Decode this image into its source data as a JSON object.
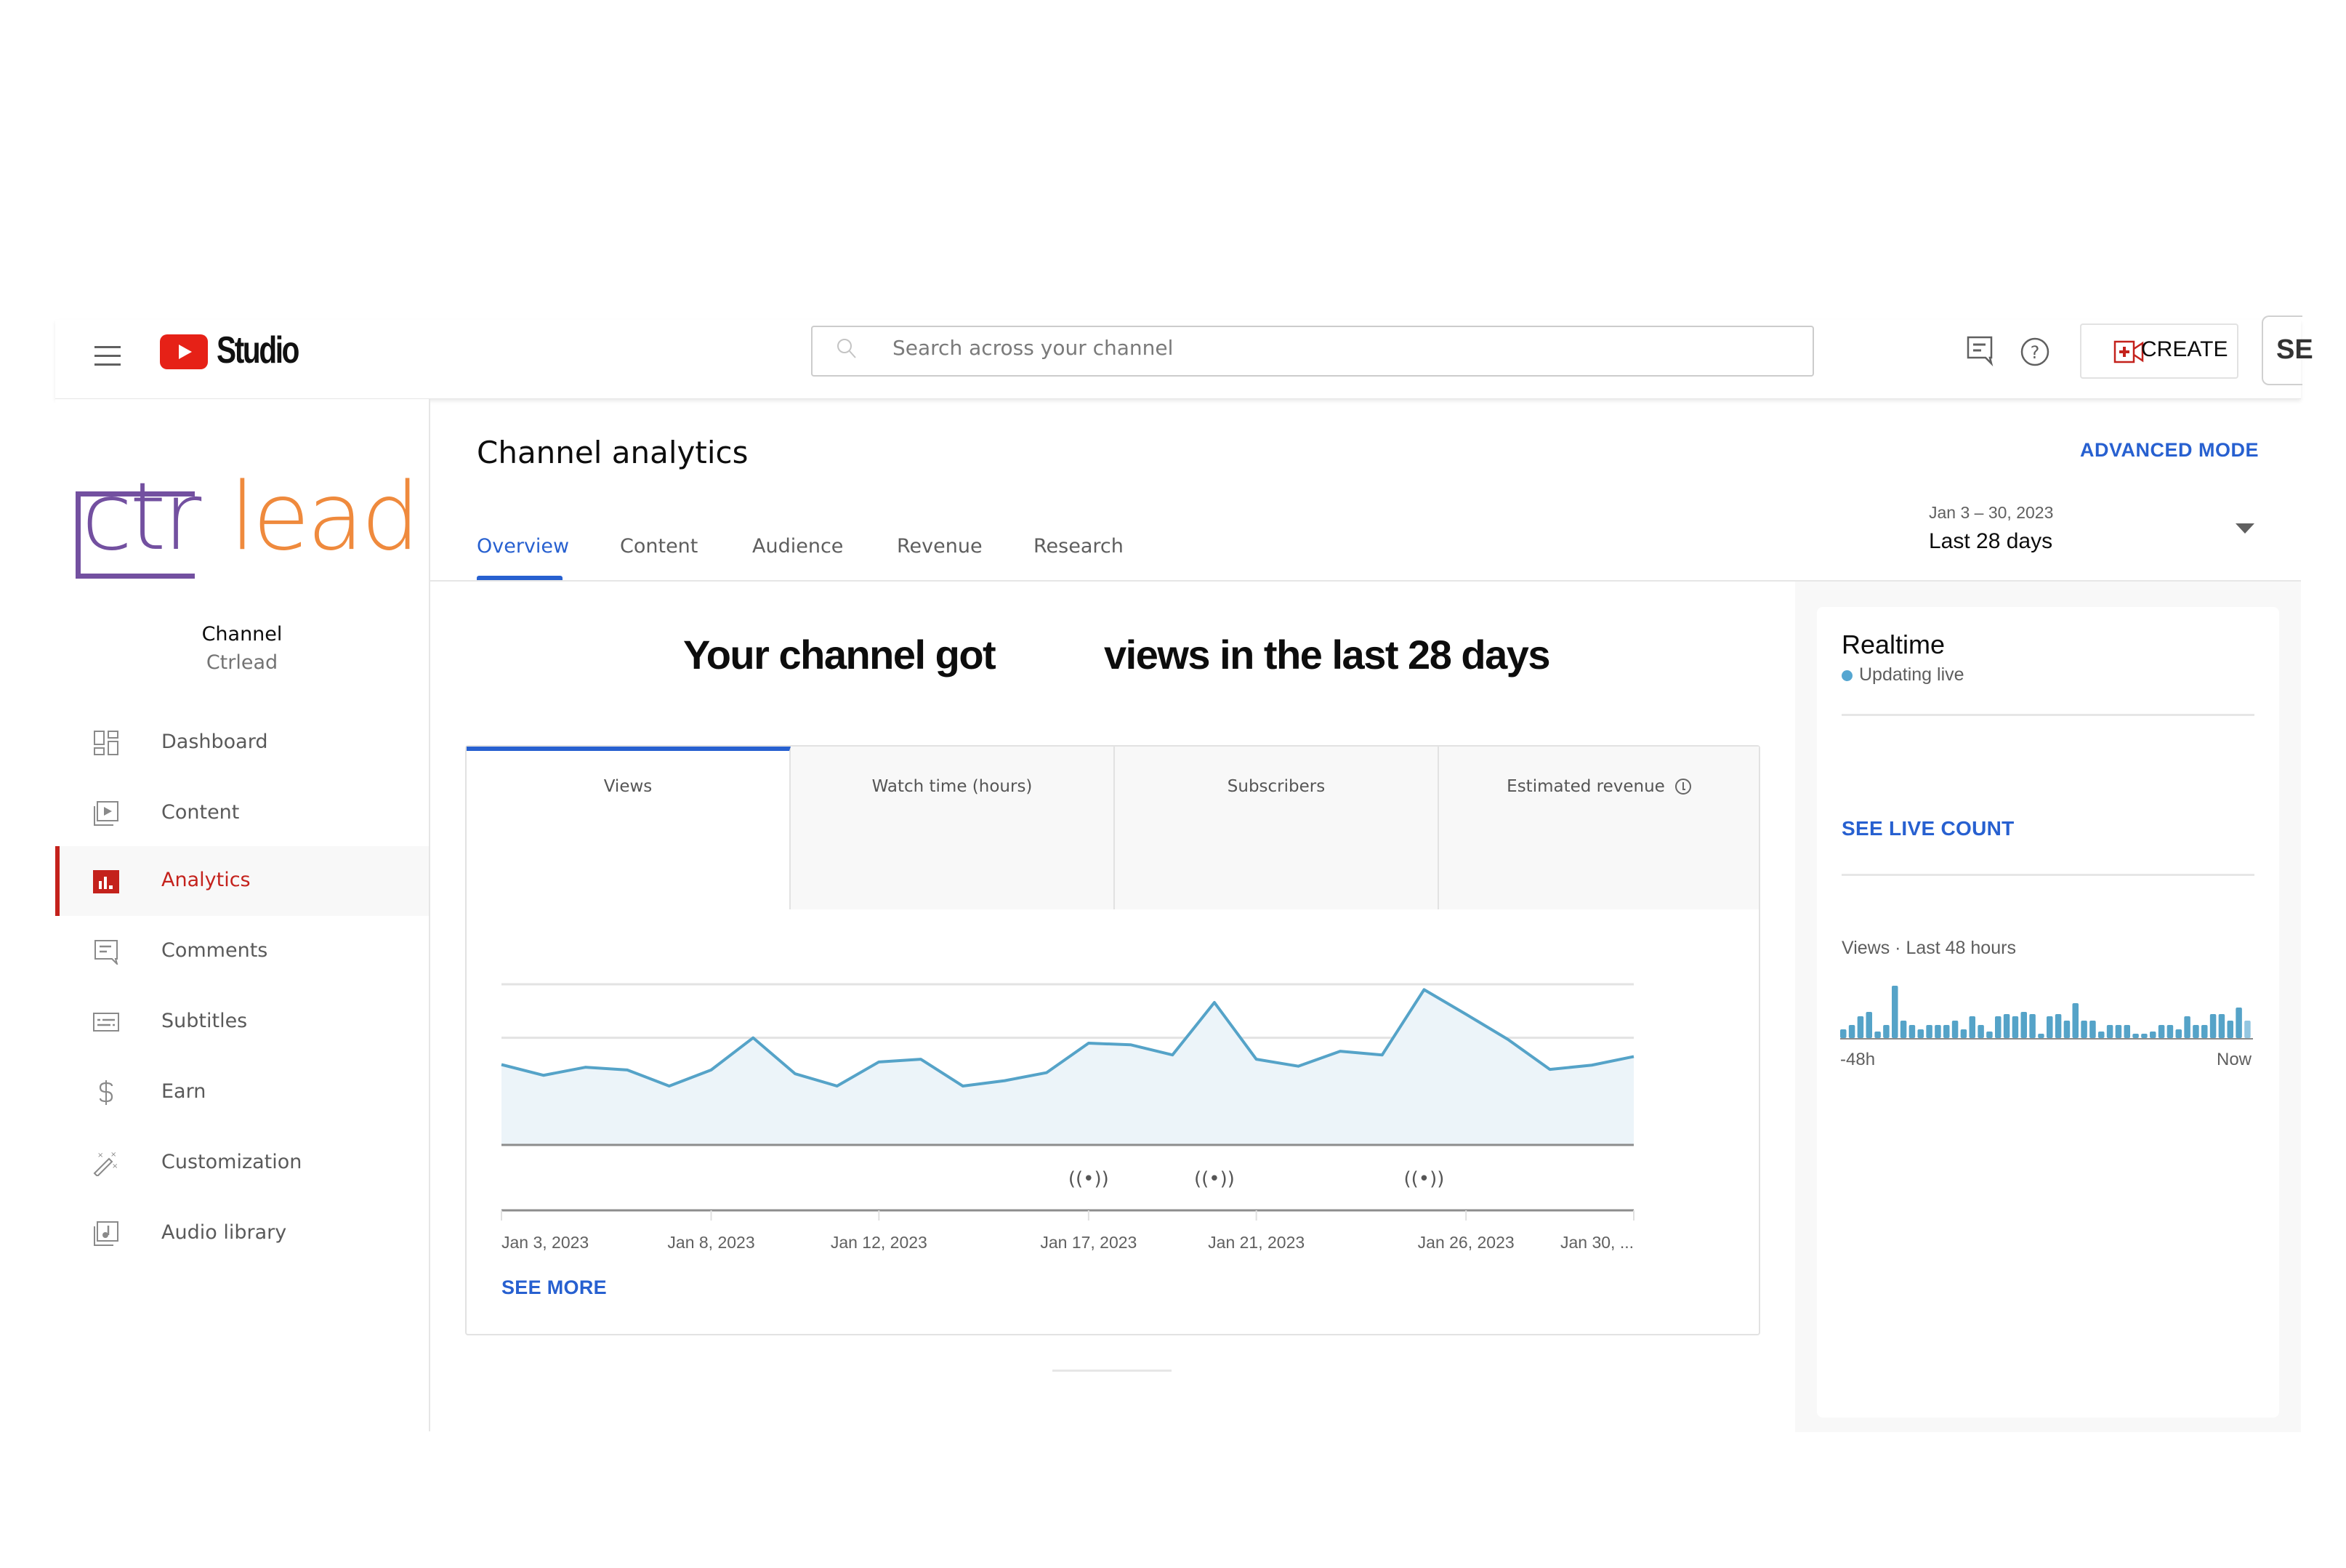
{
  "app": {
    "title": "Studio",
    "brand_color": "#e62117"
  },
  "topbar": {
    "search_placeholder": "Search across your channel",
    "create_label": "CREATE",
    "account_initials": "SE",
    "icons": [
      "menu-icon",
      "youtube-play-icon",
      "search-icon",
      "feedback-icon",
      "help-icon",
      "create-video-icon"
    ]
  },
  "sidebar": {
    "logo_text_primary": "ctr",
    "logo_text_secondary": "lead",
    "channel_label": "Channel",
    "channel_name": "Ctrlead",
    "items": [
      {
        "label": "Dashboard",
        "icon": "dashboard-icon",
        "active": false
      },
      {
        "label": "Content",
        "icon": "content-icon",
        "active": false
      },
      {
        "label": "Analytics",
        "icon": "analytics-icon",
        "active": true
      },
      {
        "label": "Comments",
        "icon": "comments-icon",
        "active": false
      },
      {
        "label": "Subtitles",
        "icon": "subtitles-icon",
        "active": false
      },
      {
        "label": "Earn",
        "icon": "dollar-icon",
        "active": false
      },
      {
        "label": "Customization",
        "icon": "magic-wand-icon",
        "active": false
      },
      {
        "label": "Audio library",
        "icon": "audio-library-icon",
        "active": false
      }
    ],
    "active_color": "#c4221c"
  },
  "main": {
    "title": "Channel analytics",
    "advanced_mode_label": "ADVANCED MODE",
    "tabs": [
      {
        "label": "Overview",
        "active": true
      },
      {
        "label": "Content",
        "active": false
      },
      {
        "label": "Audience",
        "active": false
      },
      {
        "label": "Revenue",
        "active": false
      },
      {
        "label": "Research",
        "active": false
      }
    ],
    "date_range": {
      "range_text": "Jan 3 – 30, 2023",
      "preset_label": "Last 28 days"
    },
    "headline_part1": "Your channel got",
    "headline_part2": "views in the last 28 days",
    "metric_tabs": [
      {
        "label": "Views",
        "active": true
      },
      {
        "label": "Watch time (hours)",
        "active": false
      },
      {
        "label": "Subscribers",
        "active": false
      },
      {
        "label": "Estimated revenue",
        "active": false,
        "icon": "clock-info-icon"
      }
    ],
    "see_more_label": "SEE MORE",
    "accent_color": "#2760d0"
  },
  "chart_data": [
    {
      "type": "area",
      "title": "Views",
      "xlabel": "",
      "ylabel": "",
      "grid": true,
      "y_axis_labels_visible": false,
      "ylim": [
        0,
        3
      ],
      "y_unit_note": "relative to gridline spacing (no numeric axis labels visible)",
      "x": [
        "Jan 3",
        "Jan 4",
        "Jan 5",
        "Jan 6",
        "Jan 7",
        "Jan 8",
        "Jan 9",
        "Jan 10",
        "Jan 11",
        "Jan 12",
        "Jan 13",
        "Jan 14",
        "Jan 15",
        "Jan 16",
        "Jan 17",
        "Jan 18",
        "Jan 19",
        "Jan 20",
        "Jan 21",
        "Jan 22",
        "Jan 23",
        "Jan 24",
        "Jan 25",
        "Jan 26",
        "Jan 27",
        "Jan 28",
        "Jan 29",
        "Jan 30"
      ],
      "series": [
        {
          "name": "Views",
          "color": "#55a3c8",
          "values": [
            1.5,
            1.3,
            1.45,
            1.4,
            1.1,
            1.4,
            2.0,
            1.33,
            1.1,
            1.55,
            1.6,
            1.1,
            1.2,
            1.35,
            1.9,
            1.87,
            1.68,
            2.66,
            1.6,
            1.47,
            1.75,
            1.68,
            2.9,
            2.44,
            1.97,
            1.41,
            1.49,
            1.65
          ]
        }
      ],
      "x_tick_labels": [
        {
          "label": "Jan 3, 2023",
          "index": 0
        },
        {
          "label": "Jan 8, 2023",
          "index": 5
        },
        {
          "label": "Jan 12, 2023",
          "index": 9
        },
        {
          "label": "Jan 17, 2023",
          "index": 14
        },
        {
          "label": "Jan 21, 2023",
          "index": 18
        },
        {
          "label": "Jan 26, 2023",
          "index": 23
        },
        {
          "label": "Jan 30, ...",
          "index": 27
        }
      ],
      "live_event_markers": [
        {
          "icon": "live-broadcast-icon",
          "index": 14
        },
        {
          "icon": "live-broadcast-icon",
          "index": 17
        },
        {
          "icon": "live-broadcast-icon",
          "index": 22
        }
      ]
    },
    {
      "type": "bar",
      "title": "Views · Last 48 hours",
      "xlabel": "",
      "ylabel": "",
      "x_range_labels": [
        "-48h",
        "Now"
      ],
      "ylim": [
        0,
        10
      ],
      "y_unit_note": "relative heights (no numeric axis labels visible)",
      "color": "#55a3c8",
      "values": [
        2,
        3,
        5,
        6,
        1.5,
        3,
        12,
        4,
        3,
        2,
        3,
        3,
        3,
        4,
        2,
        5,
        3,
        1.5,
        5,
        5.5,
        5,
        6,
        5.5,
        1,
        5,
        5.5,
        4,
        8,
        4,
        4,
        1.5,
        3,
        3,
        3,
        1,
        1,
        1.5,
        3,
        3,
        2,
        5,
        3,
        3,
        5.5,
        5.5,
        4,
        7,
        4
      ]
    }
  ],
  "realtime": {
    "title": "Realtime",
    "status": "Updating live",
    "status_dot_color": "#55a6d1",
    "see_live_count_label": "SEE LIVE COUNT",
    "views_label": "Views · Last 48 hours",
    "axis_left": "-48h",
    "axis_right": "Now"
  }
}
